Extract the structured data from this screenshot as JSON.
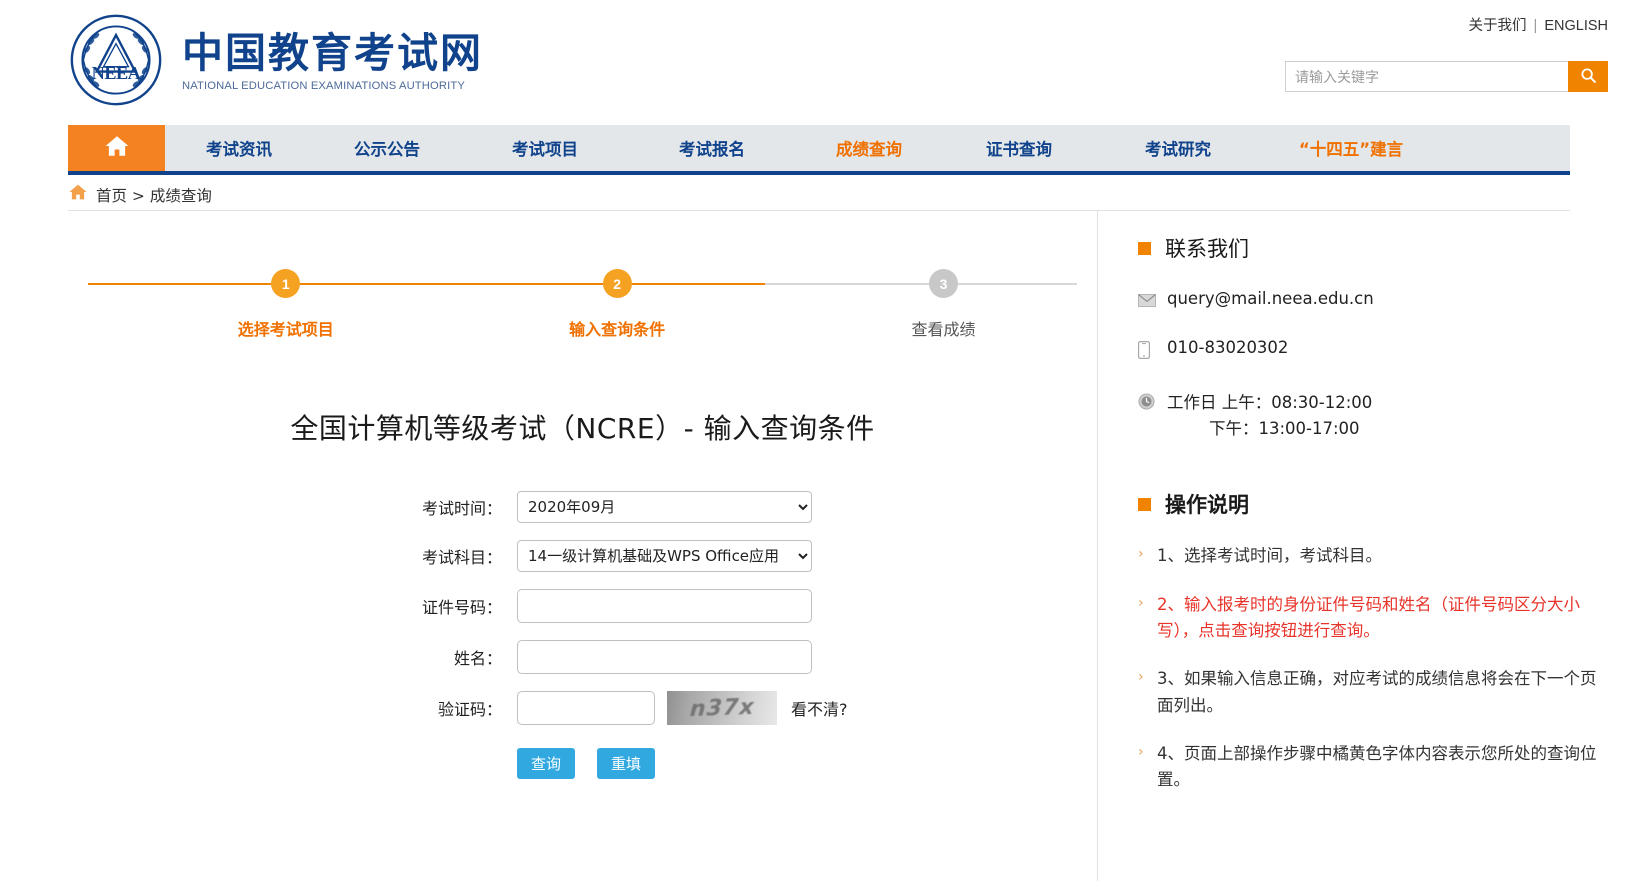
{
  "header": {
    "logo_cn": "中国教育考试网",
    "logo_en": "NATIONAL EDUCATION EXAMINATIONS AUTHORITY",
    "logo_badge": "NEEA",
    "about_label": "关于我们",
    "separator": "|",
    "english_label": "ENGLISH",
    "search_placeholder": "请输入关键字",
    "search_value": "",
    "search_icon": "search-icon"
  },
  "nav": {
    "home_icon": "home-icon",
    "items": [
      {
        "label": "考试资讯",
        "state": "normal"
      },
      {
        "label": "公示公告",
        "state": "normal"
      },
      {
        "label": "考试项目",
        "state": "normal"
      },
      {
        "label": "考试报名",
        "state": "normal"
      },
      {
        "label": "成绩查询",
        "state": "active"
      },
      {
        "label": "证书查询",
        "state": "normal"
      },
      {
        "label": "考试研究",
        "state": "normal"
      },
      {
        "label": "“十四五”建言",
        "state": "accent"
      }
    ]
  },
  "breadcrumb": {
    "home_icon": "home-icon",
    "text": "首页 > 成绩查询"
  },
  "steps": [
    {
      "number": "1",
      "label": "选择考试项目",
      "state": "active"
    },
    {
      "number": "2",
      "label": "输入查询条件",
      "state": "active"
    },
    {
      "number": "3",
      "label": "查看成绩",
      "state": "inactive"
    }
  ],
  "form": {
    "title": "全国计算机等级考试（NCRE）- 输入查询条件",
    "exam_time_label": "考试时间：",
    "exam_time_value": "2020年09月",
    "exam_subject_label": "考试科目：",
    "exam_subject_value": "14一级计算机基础及WPS Office应用",
    "id_label": "证件号码：",
    "id_value": "",
    "name_label": "姓名：",
    "name_value": "",
    "captcha_label": "验证码：",
    "captcha_value": "",
    "captcha_image_text": "n37x",
    "captcha_refresh_label": "看不清?",
    "submit_label": "查询",
    "reset_label": "重填"
  },
  "sidebar": {
    "contact_title": "联系我们",
    "email_icon": "mail-icon",
    "email": "query@mail.neea.edu.cn",
    "phone_icon": "phone-icon",
    "phone": "010-83020302",
    "clock_icon": "clock-icon",
    "hours_morning": "工作日 上午：08:30-12:00",
    "hours_afternoon": "下午：13:00-17:00",
    "notes_title": "操作说明",
    "notes": [
      {
        "text": "1、选择考试时间，考试科目。",
        "style": "normal"
      },
      {
        "text": "2、输入报考时的身份证件号码和姓名（证件号码区分大小写），点击查询按钮进行查询。",
        "style": "warn"
      },
      {
        "text": "3、如果输入信息正确，对应考试的成绩信息将会在下一个页面列出。",
        "style": "normal"
      },
      {
        "text": "4、页面上部操作步骤中橘黄色字体内容表示您所处的查询位置。",
        "style": "normal"
      }
    ]
  },
  "colors": {
    "orange": "#f08300",
    "navy": "#10438c",
    "blue_button": "#31a9e0",
    "red": "#e8342a"
  }
}
